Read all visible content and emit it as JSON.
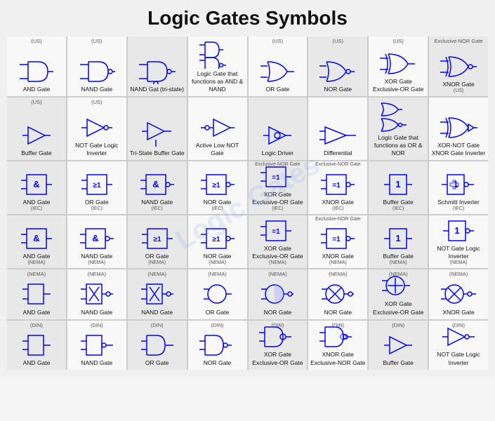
{
  "title": "Logic Gates Symbols",
  "rows": [
    {
      "cells": [
        {
          "sub": "(US)",
          "label": "AND Gate",
          "type": "and_us"
        },
        {
          "sub": "(US)",
          "label": "NAND Gate",
          "type": "nand_us"
        },
        {
          "sub": "",
          "label": "NAND Gat (tri-state)",
          "type": "nand_tri"
        },
        {
          "sub": "",
          "label": "Logic Gate that functions as AND & NAND",
          "type": "and_nand"
        },
        {
          "sub": "(US)",
          "label": "OR Gate",
          "type": "or_us"
        },
        {
          "sub": "(US)",
          "label": "NOR Gate",
          "type": "nor_us"
        },
        {
          "sub": "(US)",
          "label": "XOR Gate Exclusive-OR Gate",
          "type": "xor_us"
        },
        {
          "sub": "Exclusive-NOR Gate",
          "label": "XNOR Gate",
          "type": "xnor_us",
          "sub2": "(US)"
        }
      ]
    },
    {
      "cells": [
        {
          "sub": "(US)",
          "label": "Buffer Gate",
          "type": "buffer_us"
        },
        {
          "sub": "(US)",
          "label": "NOT Gate Logic Inverter",
          "type": "not_us"
        },
        {
          "sub": "",
          "label": "Tri-State Buffer Gate",
          "type": "tribuf"
        },
        {
          "sub": "",
          "label": "Active Low NOT Gate",
          "type": "active_low_not"
        },
        {
          "sub": "",
          "label": "Logic Driver",
          "type": "logic_driver"
        },
        {
          "sub": "",
          "label": "Differential",
          "type": "differential"
        },
        {
          "sub": "",
          "label": "Logic Gate that functions as OR & NOR",
          "type": "or_nor"
        },
        {
          "sub": "",
          "label": "XOR-NOT Gate XNOR Gate Inverter",
          "type": "xornot"
        }
      ]
    },
    {
      "cells": [
        {
          "sub": "",
          "label": "AND Gate",
          "type": "iec_and",
          "symbol": "&"
        },
        {
          "sub": "",
          "label": "OR Gate",
          "type": "iec_or",
          "symbol": "≥1"
        },
        {
          "sub": "",
          "label": "NAND Gate",
          "type": "iec_nand",
          "symbol": "&"
        },
        {
          "sub": "",
          "label": "NOR Gate",
          "type": "iec_nor",
          "symbol": "≥1"
        },
        {
          "sub": "",
          "label": "XOR Gate Exclusive-OR Gate",
          "type": "iec_xor",
          "symbol": "=1"
        },
        {
          "sub": "Exclusive-NOR Gate",
          "label": "XNOR Gate",
          "type": "iec_xnor",
          "symbol": "=1"
        },
        {
          "sub": "",
          "label": "Buffer Gate",
          "type": "iec_buf",
          "symbol": "1"
        },
        {
          "sub": "",
          "label": "Schmitt Inverter",
          "type": "schmitt",
          "symbol": "1"
        }
      ],
      "sublabels": [
        "(IEC)",
        "(IEC)",
        "(IEC)",
        "(IEC)",
        "(IEC)",
        "Exclusive-NOR Gate\n(IEC)",
        "(IEC)",
        "(IEC)"
      ]
    },
    {
      "cells": [
        {
          "sub": "",
          "label": "AND Gate",
          "type": "iec2_and",
          "symbol": "&"
        },
        {
          "sub": "",
          "label": "NAND Gate",
          "type": "iec2_nand",
          "symbol": "&"
        },
        {
          "sub": "",
          "label": "OR Gate",
          "type": "iec2_or",
          "symbol": "≥1"
        },
        {
          "sub": "",
          "label": "NOR Gate",
          "type": "iec2_nor",
          "symbol": "≥1"
        },
        {
          "sub": "",
          "label": "XOR Gate Exclusive-OR Gate",
          "type": "iec2_xor",
          "symbol": "=1"
        },
        {
          "sub": "Exclusive-NOR Gate",
          "label": "XNOR Gate",
          "type": "iec2_xnor",
          "symbol": "=1"
        },
        {
          "sub": "",
          "label": "Buffer Gate",
          "type": "iec2_buf",
          "symbol": "1"
        },
        {
          "sub": "",
          "label": "NOT Gate Logic Inverter",
          "type": "iec2_not",
          "symbol": "1"
        }
      ],
      "sublabels": [
        "(NEMA)",
        "(NEMA)",
        "(NEMA)",
        "(NEMA)",
        "(NEMA)",
        "(NEMA)",
        "(NEMA)",
        "(NEMA)"
      ]
    },
    {
      "cells": [
        {
          "sub": "(NEMA)",
          "label": "AND Gate",
          "type": "nema_and"
        },
        {
          "sub": "(NEMA)",
          "label": "NAND Gate",
          "type": "nema_nand"
        },
        {
          "sub": "(NEMA)",
          "label": "NAND Gate",
          "type": "nema_nand2"
        },
        {
          "sub": "(NEMA)",
          "label": "OR Gate",
          "type": "nema_or"
        },
        {
          "sub": "(NEMA)",
          "label": "NOR Gate",
          "type": "nema_nor"
        },
        {
          "sub": "(NEMA)",
          "label": "NOR Gate",
          "type": "nema_nor2"
        },
        {
          "sub": "(NEMA)",
          "label": "XOR Gate Exclusive-OR Gate",
          "type": "nema_xor"
        },
        {
          "sub": "(NEMA)",
          "label": "XNOR Gate",
          "type": "nema_xnor"
        }
      ]
    },
    {
      "cells": [
        {
          "sub": "(DIN)",
          "label": "AND Gate",
          "type": "din_and"
        },
        {
          "sub": "(DIN)",
          "label": "NAND Gate",
          "type": "din_nand"
        },
        {
          "sub": "(DIN)",
          "label": "OR Gate",
          "type": "din_or"
        },
        {
          "sub": "(DIN)",
          "label": "NOR Gate",
          "type": "din_nor"
        },
        {
          "sub": "(DIN)",
          "label": "XOR Gate Exclusive-OR Gate",
          "type": "din_xor"
        },
        {
          "sub": "(DIN)",
          "label": "XNOR Gate Exclusive-NOR Gate",
          "type": "din_xnor"
        },
        {
          "sub": "(DIN)",
          "label": "Buffer Gate",
          "type": "din_buf"
        },
        {
          "sub": "(DIN)",
          "label": "NOT Gate Logic Inverter",
          "type": "din_not"
        }
      ]
    }
  ]
}
